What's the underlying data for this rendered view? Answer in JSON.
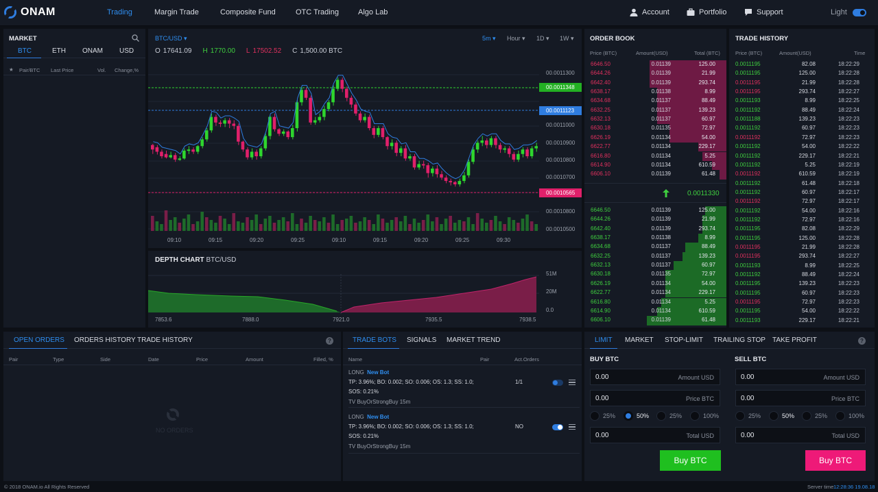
{
  "brand": "ONAM",
  "nav": [
    "Trading",
    "Margin Trade",
    "Composite Fund",
    "OTC Trading",
    "Algo Lab"
  ],
  "header_right": {
    "account": "Account",
    "portfolio": "Portfolio",
    "support": "Support",
    "theme": "Light"
  },
  "market": {
    "title": "MARKET",
    "tabs": [
      "BTC",
      "ETH",
      "ONAM",
      "USD"
    ],
    "columns": [
      "Pair/BTC",
      "Last Price",
      "Vol.",
      "Change,%"
    ]
  },
  "chart": {
    "pair": "BTC/USD",
    "timeframes": [
      "5m",
      "Hour",
      "1D",
      "1W"
    ],
    "ohlc": {
      "o_label": "O",
      "o": "17641.09",
      "h_label": "H",
      "h": "1770.00",
      "l_label": "L",
      "l": "17502.52",
      "c_label": "C",
      "c": "1,500.00 BTC"
    },
    "y_ticks": [
      "00.0011300",
      "00.0011000",
      "00.0010900",
      "00.0010800",
      "00.0010700",
      "00.0010800",
      "00.0010500"
    ],
    "price_labels": {
      "green": "00.0011348",
      "blue": "00.0011123",
      "red": "00.0010565"
    },
    "x_ticks": [
      "09:10",
      "09:15",
      "09:20",
      "09:25",
      "09:10",
      "09:15",
      "09:20",
      "09:25",
      "09:30"
    ],
    "colors": {
      "up": "#2ed62e",
      "down": "#e0206a",
      "line": "#2f7de0"
    }
  },
  "depth": {
    "title": "DEPTH CHART",
    "pair": "BTC/USD",
    "y_ticks": [
      "51M",
      "20M",
      "0.0"
    ],
    "x_ticks": [
      "7853.6",
      "7888.0",
      "7921.0",
      "7935.5",
      "7938.5"
    ]
  },
  "order_book": {
    "title": "ORDER BOOK",
    "columns": [
      "Price (BTC)",
      "Amount(USD)",
      "Total (BTC)"
    ],
    "asks": [
      {
        "price": "6646.50",
        "amount": "0.01139",
        "total": "125.00",
        "depth": 0.54
      },
      {
        "price": "6644.26",
        "amount": "0.01139",
        "total": "21.99",
        "depth": 0.54
      },
      {
        "price": "6642.40",
        "amount": "0.01139",
        "total": "293.74",
        "depth": 0.54
      },
      {
        "price": "6638.17",
        "amount": "0.01138",
        "total": "8.99",
        "depth": 0.49
      },
      {
        "price": "6634.68",
        "amount": "0.01137",
        "total": "88.49",
        "depth": 0.49
      },
      {
        "price": "6632.25",
        "amount": "0.01137",
        "total": "139.23",
        "depth": 0.49
      },
      {
        "price": "6632.13",
        "amount": "0.01137",
        "total": "60.97",
        "depth": 0.49
      },
      {
        "price": "6630.18",
        "amount": "0.01135",
        "total": "72.97",
        "depth": 0.4
      },
      {
        "price": "6626.19",
        "amount": "0.01134",
        "total": "54.00",
        "depth": 0.4
      },
      {
        "price": "6622.77",
        "amount": "0.01134",
        "total": "229.17",
        "depth": 0.2
      },
      {
        "price": "6616.80",
        "amount": "0.01134",
        "total": "5.25",
        "depth": 0.17
      },
      {
        "price": "6614.90",
        "amount": "0.01134",
        "total": "610.59",
        "depth": 0.1
      },
      {
        "price": "6606.10",
        "amount": "0.01139",
        "total": "61.48",
        "depth": 0.05
      }
    ],
    "mid_price": "0.0011330",
    "bids": [
      {
        "price": "6646.50",
        "amount": "0.01139",
        "total": "125.00",
        "depth": 0.15
      },
      {
        "price": "6644.26",
        "amount": "0.01139",
        "total": "21.99",
        "depth": 0.17
      },
      {
        "price": "6642.40",
        "amount": "0.01139",
        "total": "293.74",
        "depth": 0.17
      },
      {
        "price": "6638.17",
        "amount": "0.01138",
        "total": "8.99",
        "depth": 0.2
      },
      {
        "price": "6634.68",
        "amount": "0.01137",
        "total": "88.49",
        "depth": 0.29
      },
      {
        "price": "6632.25",
        "amount": "0.01137",
        "total": "139.23",
        "depth": 0.31
      },
      {
        "price": "6632.13",
        "amount": "0.01137",
        "total": "60.97",
        "depth": 0.37
      },
      {
        "price": "6630.18",
        "amount": "0.01135",
        "total": "72.97",
        "depth": 0.43
      },
      {
        "price": "6626.19",
        "amount": "0.01134",
        "total": "54.00",
        "depth": 0.43
      },
      {
        "price": "6622.77",
        "amount": "0.01134",
        "total": "229.17",
        "depth": 0.43
      },
      {
        "price": "6616.80",
        "amount": "0.01134",
        "total": "5.25",
        "depth": 0.46
      },
      {
        "price": "6614.90",
        "amount": "0.01134",
        "total": "610.59",
        "depth": 0.49
      },
      {
        "price": "6606.10",
        "amount": "0.01139",
        "total": "61.48",
        "depth": 0.56
      }
    ]
  },
  "trade_history": {
    "title": "TRADE HISTORY",
    "columns": [
      "Price (BTC)",
      "Amount(USD)",
      "Time"
    ],
    "rows": [
      {
        "price": "0.0011195",
        "amount": "82.08",
        "time": "18:22:29",
        "side": "buy"
      },
      {
        "price": "0.0011195",
        "amount": "125.00",
        "time": "18:22:28",
        "side": "buy"
      },
      {
        "price": "0.0011195",
        "amount": "21.99",
        "time": "18:22:28",
        "side": "sell"
      },
      {
        "price": "0.0011195",
        "amount": "293.74",
        "time": "18:22:27",
        "side": "sell"
      },
      {
        "price": "0.0011193",
        "amount": "8.99",
        "time": "18:22:25",
        "side": "buy"
      },
      {
        "price": "0.0011192",
        "amount": "88.49",
        "time": "18:22:24",
        "side": "buy"
      },
      {
        "price": "0.0011188",
        "amount": "139.23",
        "time": "18:22:23",
        "side": "buy"
      },
      {
        "price": "0.0011192",
        "amount": "60.97",
        "time": "18:22:23",
        "side": "buy"
      },
      {
        "price": "0.0011192",
        "amount": "72.97",
        "time": "18:22:23",
        "side": "sell"
      },
      {
        "price": "0.0011192",
        "amount": "54.00",
        "time": "18:22:22",
        "side": "buy"
      },
      {
        "price": "0.0011192",
        "amount": "229.17",
        "time": "18:22:21",
        "side": "buy"
      },
      {
        "price": "0.0011192",
        "amount": "5.25",
        "time": "18:22:19",
        "side": "buy"
      },
      {
        "price": "0.0011192",
        "amount": "610.59",
        "time": "18:22:19",
        "side": "sell"
      },
      {
        "price": "0.0011192",
        "amount": "61.48",
        "time": "18:22:18",
        "side": "buy"
      },
      {
        "price": "0.0011192",
        "amount": "60.97",
        "time": "18:22:17",
        "side": "buy"
      },
      {
        "price": "0.0011192",
        "amount": "72.97",
        "time": "18:22:17",
        "side": "sell"
      },
      {
        "price": "0.0011192",
        "amount": "54.00",
        "time": "18:22:16",
        "side": "buy"
      },
      {
        "price": "0.0011192",
        "amount": "72.97",
        "time": "18:22:16",
        "side": "buy"
      },
      {
        "price": "0.0011195",
        "amount": "82.08",
        "time": "18:22:29",
        "side": "buy"
      },
      {
        "price": "0.0011195",
        "amount": "125.00",
        "time": "18:22:28",
        "side": "buy"
      },
      {
        "price": "0.0011195",
        "amount": "21.99",
        "time": "18:22:28",
        "side": "sell"
      },
      {
        "price": "0.0011195",
        "amount": "293.74",
        "time": "18:22:27",
        "side": "sell"
      },
      {
        "price": "0.0011193",
        "amount": "8.99",
        "time": "18:22:25",
        "side": "buy"
      },
      {
        "price": "0.0011192",
        "amount": "88.49",
        "time": "18:22:24",
        "side": "buy"
      },
      {
        "price": "0.0011195",
        "amount": "139.23",
        "time": "18:22:23",
        "side": "buy"
      },
      {
        "price": "0.0011195",
        "amount": "60.97",
        "time": "18:22:23",
        "side": "buy"
      },
      {
        "price": "0.0011195",
        "amount": "72.97",
        "time": "18:22:23",
        "side": "sell"
      },
      {
        "price": "0.0011195",
        "amount": "54.00",
        "time": "18:22:22",
        "side": "buy"
      },
      {
        "price": "0.0011193",
        "amount": "229.17",
        "time": "18:22:21",
        "side": "buy"
      }
    ]
  },
  "orders": {
    "tabs": [
      "OPEN ORDERS",
      "ORDERS HISTORY",
      "TRADE HISTORY"
    ],
    "columns": [
      "Pair",
      "Type",
      "Side",
      "Date",
      "Price",
      "Amount",
      "Filled, %"
    ],
    "empty": "NO ORDERS"
  },
  "bots": {
    "tabs": [
      "TRADE BOTS",
      "SIGNALS",
      "MARKET TREND"
    ],
    "columns": [
      "Name",
      "Pair",
      "Act.Orders"
    ],
    "items": [
      {
        "side": "LONG",
        "link": "New Bot",
        "params1": "TP: 3.96%; BO: 0.002; SO: 0.006; OS: 1.3; SS: 1.0;",
        "params2": "SOS: 0.21%",
        "strategy": "TV BuyOrStrongBuy 15m",
        "orders": "1/1",
        "enabled": false
      },
      {
        "side": "LONG",
        "link": "New Bot",
        "params1": "TP: 3.96%; BO: 0.002; SO: 0.006; OS: 1.3; SS: 1.0;",
        "params2": "SOS: 0.21%",
        "strategy": "TV BuyOrStrongBuy 15m",
        "orders": "NO",
        "enabled": true
      }
    ]
  },
  "trade": {
    "tabs": [
      "LIMIT",
      "MARKET",
      "STOP-LIMIT",
      "TRAILING STOP",
      "TAKE PROFIT"
    ],
    "buy": {
      "title": "BUY BTC",
      "amount": "0.00",
      "amount_label": "Amount USD",
      "price": "0.00",
      "price_label": "Price BTC",
      "pcts": [
        "25%",
        "50%",
        "25%",
        "100%"
      ],
      "total": "0.00",
      "total_label": "Total USD",
      "button": "Buy BTC"
    },
    "sell": {
      "title": "SELL BTC",
      "amount": "0.00",
      "amount_label": "Amount USD",
      "price": "0.00",
      "price_label": "Price BTC",
      "pcts": [
        "25%",
        "50%",
        "25%",
        "100%"
      ],
      "total": "0.00",
      "total_label": "Total USD",
      "button": "Buy BTC"
    }
  },
  "footer": {
    "copyright": "© 2018 ONAM.io All Rights Reserved",
    "server_label": "Server time",
    "server_time": "12:28:36 19.08.18"
  },
  "candles": [
    [
      120,
      112,
      104,
      122
    ],
    [
      116,
      108,
      103,
      120
    ],
    [
      108,
      100,
      96,
      112
    ],
    [
      104,
      98,
      96,
      110
    ],
    [
      98,
      102,
      96,
      108
    ],
    [
      102,
      94,
      90,
      106
    ],
    [
      94,
      96,
      92,
      100
    ],
    [
      96,
      110,
      94,
      114
    ],
    [
      110,
      112,
      104,
      118
    ],
    [
      112,
      108,
      104,
      116
    ],
    [
      108,
      118,
      104,
      120
    ],
    [
      118,
      130,
      114,
      134
    ],
    [
      130,
      146,
      126,
      150
    ],
    [
      146,
      170,
      142,
      176
    ],
    [
      170,
      160,
      154,
      174
    ],
    [
      160,
      158,
      152,
      164
    ],
    [
      158,
      164,
      152,
      168
    ],
    [
      164,
      158,
      150,
      168
    ],
    [
      158,
      154,
      148,
      164
    ],
    [
      154,
      126,
      120,
      158
    ],
    [
      126,
      112,
      108,
      128
    ],
    [
      112,
      98,
      94,
      116
    ],
    [
      98,
      108,
      94,
      114
    ],
    [
      108,
      100,
      94,
      112
    ],
    [
      100,
      114,
      96,
      118
    ],
    [
      114,
      136,
      110,
      140
    ],
    [
      136,
      170,
      130,
      172
    ],
    [
      170,
      148,
      144,
      176
    ],
    [
      148,
      140,
      136,
      150
    ],
    [
      140,
      144,
      136,
      148
    ],
    [
      144,
      134,
      130,
      146
    ],
    [
      134,
      150,
      130,
      156
    ],
    [
      150,
      196,
      144,
      200
    ],
    [
      196,
      218,
      190,
      222
    ],
    [
      218,
      204,
      200,
      222
    ],
    [
      204,
      160,
      156,
      208
    ],
    [
      160,
      164,
      156,
      170
    ],
    [
      164,
      170,
      160,
      176
    ],
    [
      170,
      184,
      164,
      190
    ],
    [
      184,
      196,
      180,
      200
    ],
    [
      196,
      220,
      190,
      226
    ],
    [
      220,
      236,
      216,
      240
    ],
    [
      236,
      220,
      214,
      240
    ],
    [
      220,
      204,
      198,
      224
    ],
    [
      204,
      192,
      186,
      208
    ],
    [
      192,
      176,
      172,
      196
    ],
    [
      176,
      164,
      160,
      180
    ],
    [
      164,
      170,
      160,
      176
    ],
    [
      170,
      150,
      146,
      174
    ],
    [
      150,
      138,
      132,
      154
    ],
    [
      138,
      150,
      134,
      154
    ],
    [
      150,
      134,
      130,
      154
    ],
    [
      134,
      118,
      112,
      136
    ],
    [
      118,
      124,
      112,
      130
    ],
    [
      124,
      106,
      100,
      128
    ],
    [
      106,
      114,
      100,
      118
    ],
    [
      114,
      96,
      92,
      120
    ],
    [
      96,
      100,
      92,
      104
    ],
    [
      100,
      80,
      76,
      104
    ],
    [
      80,
      86,
      76,
      92
    ],
    [
      86,
      84,
      78,
      92
    ],
    [
      84,
      70,
      62,
      88
    ],
    [
      70,
      78,
      64,
      82
    ],
    [
      78,
      68,
      62,
      84
    ],
    [
      68,
      62,
      58,
      74
    ],
    [
      62,
      56,
      52,
      66
    ],
    [
      56,
      54,
      48,
      60
    ],
    [
      54,
      50,
      46,
      56
    ],
    [
      50,
      56,
      46,
      60
    ],
    [
      56,
      66,
      52,
      72
    ],
    [
      66,
      90,
      62,
      94
    ],
    [
      90,
      112,
      86,
      116
    ],
    [
      112,
      124,
      106,
      128
    ],
    [
      124,
      128,
      118,
      136
    ],
    [
      128,
      120,
      114,
      132
    ],
    [
      120,
      132,
      116,
      136
    ],
    [
      132,
      120,
      114,
      136
    ],
    [
      120,
      112,
      106,
      124
    ],
    [
      112,
      114,
      106,
      118
    ],
    [
      114,
      104,
      98,
      118
    ],
    [
      104,
      94,
      90,
      108
    ],
    [
      94,
      104,
      90,
      110
    ],
    [
      104,
      112,
      98,
      116
    ],
    [
      112,
      100,
      96,
      116
    ],
    [
      100,
      114,
      96,
      118
    ],
    [
      114,
      118,
      108,
      124
    ]
  ],
  "volume": [
    22,
    14,
    10,
    30,
    16,
    20,
    12,
    18,
    24,
    10,
    14,
    28,
    20,
    16,
    12,
    22,
    18,
    10,
    26,
    14,
    12,
    20,
    16,
    24,
    10,
    18,
    22,
    12,
    16,
    20,
    14,
    26,
    10,
    18,
    12,
    22,
    16,
    14,
    20,
    12,
    24,
    10,
    16,
    18,
    22,
    12,
    14,
    20,
    16,
    10,
    24,
    18,
    12,
    16,
    20,
    14,
    22,
    10,
    18,
    12,
    16,
    24,
    14,
    20,
    10,
    18,
    22,
    12,
    16,
    14,
    20,
    10,
    26,
    18,
    12,
    16,
    22,
    14,
    10,
    20,
    16,
    12,
    18,
    24,
    14,
    10
  ]
}
